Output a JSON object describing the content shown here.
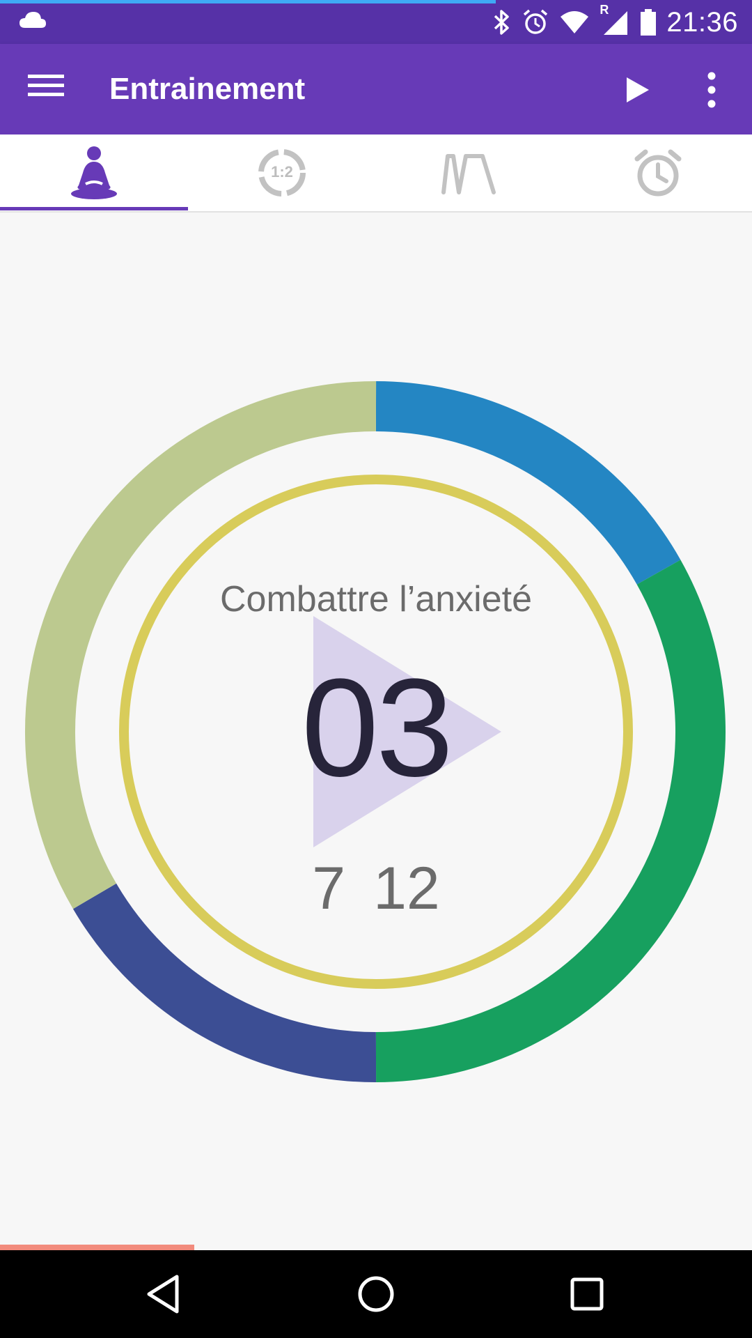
{
  "status_bar": {
    "time": "21:36",
    "left_icons": [
      "cloud-icon"
    ],
    "right_icons": [
      "bluetooth-icon",
      "alarm-icon",
      "wifi-icon",
      "signal-roaming-icon",
      "battery-icon"
    ],
    "roaming_mark": "R"
  },
  "app_bar": {
    "title": "Entrainement",
    "actions": [
      "menu-icon",
      "play-icon",
      "more-vertical-icon"
    ],
    "color": "#673ab7"
  },
  "tabs": [
    {
      "icon": "meditation-icon",
      "selected": true
    },
    {
      "icon": "ratio-timer-icon",
      "label": "1:2",
      "selected": false
    },
    {
      "icon": "breathing-pattern-icon",
      "selected": false
    },
    {
      "icon": "alarm-clock-icon",
      "selected": false
    }
  ],
  "session": {
    "exercise_name": "Combattre l’anxieté",
    "counter": "03",
    "cycle_values": [
      "7",
      "12"
    ],
    "ring_segments": [
      {
        "phase": "top-right",
        "color": "#2486c3"
      },
      {
        "phase": "right",
        "color": "#17a05f"
      },
      {
        "phase": "bottom-left",
        "color": "#3c4e94"
      },
      {
        "phase": "left",
        "color": "#bcc98f"
      }
    ],
    "inner_ring_color": "#d8cc5a",
    "play_overlay_color": "#d9d2ec"
  },
  "nav_bar": {
    "buttons": [
      "back-icon",
      "home-icon",
      "recents-icon"
    ]
  }
}
